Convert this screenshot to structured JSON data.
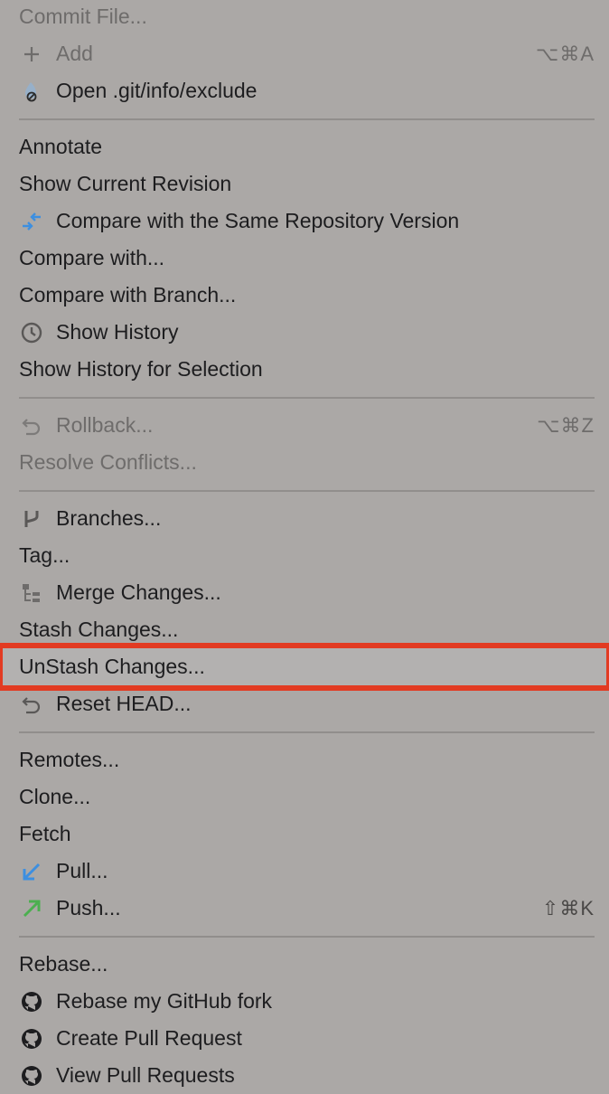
{
  "menu": {
    "items": [
      {
        "label": "Commit File...",
        "shortcut": "",
        "icon": "",
        "disabled": true
      },
      {
        "label": "Add",
        "shortcut": "⌥⌘A",
        "icon": "plus-icon",
        "disabled": true
      },
      {
        "label": "Open .git/info/exclude",
        "shortcut": "",
        "icon": "ignored-file-icon",
        "disabled": false
      },
      {
        "label": "Annotate",
        "shortcut": "",
        "icon": "",
        "disabled": false
      },
      {
        "label": "Show Current Revision",
        "shortcut": "",
        "icon": "",
        "disabled": false
      },
      {
        "label": "Compare with the Same Repository Version",
        "shortcut": "",
        "icon": "compare-arrows-icon",
        "disabled": false
      },
      {
        "label": "Compare with...",
        "shortcut": "",
        "icon": "",
        "disabled": false
      },
      {
        "label": "Compare with Branch...",
        "shortcut": "",
        "icon": "",
        "disabled": false
      },
      {
        "label": "Show History",
        "shortcut": "",
        "icon": "clock-icon",
        "disabled": false
      },
      {
        "label": "Show History for Selection",
        "shortcut": "",
        "icon": "",
        "disabled": false
      },
      {
        "label": "Rollback...",
        "shortcut": "⌥⌘Z",
        "icon": "undo-icon",
        "disabled": true
      },
      {
        "label": "Resolve Conflicts...",
        "shortcut": "",
        "icon": "",
        "disabled": true
      },
      {
        "label": "Branches...",
        "shortcut": "",
        "icon": "branch-icon",
        "disabled": false
      },
      {
        "label": "Tag...",
        "shortcut": "",
        "icon": "",
        "disabled": false
      },
      {
        "label": "Merge Changes...",
        "shortcut": "",
        "icon": "merge-icon",
        "disabled": false
      },
      {
        "label": "Stash Changes...",
        "shortcut": "",
        "icon": "",
        "disabled": false
      },
      {
        "label": "UnStash Changes...",
        "shortcut": "",
        "icon": "",
        "disabled": false
      },
      {
        "label": "Reset HEAD...",
        "shortcut": "",
        "icon": "undo-icon",
        "disabled": false
      },
      {
        "label": "Remotes...",
        "shortcut": "",
        "icon": "",
        "disabled": false
      },
      {
        "label": "Clone...",
        "shortcut": "",
        "icon": "",
        "disabled": false
      },
      {
        "label": "Fetch",
        "shortcut": "",
        "icon": "",
        "disabled": false
      },
      {
        "label": "Pull...",
        "shortcut": "",
        "icon": "pull-arrow-icon",
        "disabled": false
      },
      {
        "label": "Push...",
        "shortcut": "⇧⌘K",
        "icon": "push-arrow-icon",
        "disabled": false
      },
      {
        "label": "Rebase...",
        "shortcut": "",
        "icon": "",
        "disabled": false
      },
      {
        "label": "Rebase my GitHub fork",
        "shortcut": "",
        "icon": "github-icon",
        "disabled": false
      },
      {
        "label": "Create Pull Request",
        "shortcut": "",
        "icon": "github-icon",
        "disabled": false
      },
      {
        "label": "View Pull Requests",
        "shortcut": "",
        "icon": "github-icon",
        "disabled": false
      }
    ]
  },
  "colors": {
    "background": "#aba8a6",
    "highlight_border": "#e23b22",
    "compare_icon": "#3d8fe0",
    "pull_icon": "#3d8fe0",
    "push_icon": "#4caf50"
  }
}
